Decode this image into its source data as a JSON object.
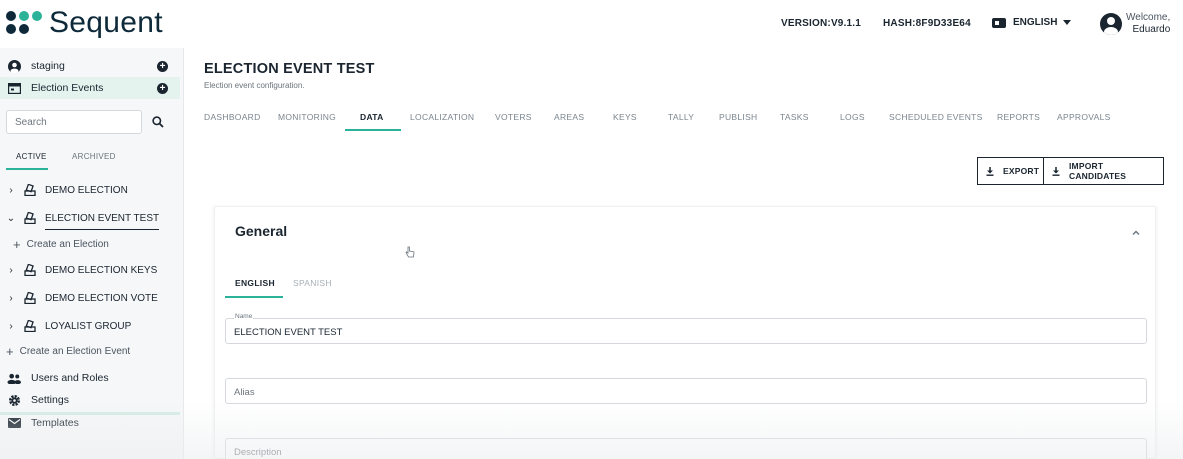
{
  "app": {
    "logo_text": "Sequent"
  },
  "header": {
    "version": "VERSION:V9.1.1",
    "hash": "HASH:8F9D33E64",
    "language": "ENGLISH",
    "welcome": "Welcome,",
    "user_name": "Eduardo"
  },
  "sidebar": {
    "tenant": "staging",
    "section": "Election Events",
    "search_placeholder": "Search",
    "tabs": {
      "active": "ACTIVE",
      "archived": "ARCHIVED"
    },
    "tree": [
      {
        "label": "DEMO ELECTION",
        "expanded": false
      },
      {
        "label": "ELECTION EVENT TEST",
        "expanded": true
      },
      {
        "label": "DEMO ELECTION KEYS",
        "expanded": false
      },
      {
        "label": "DEMO ELECTION VOTE",
        "expanded": false
      },
      {
        "label": "LOYALIST GROUP",
        "expanded": false
      }
    ],
    "create_election": "Create an Election",
    "create_event": "Create an Election Event",
    "bottom": [
      {
        "label": "Users and Roles",
        "icon": "users-icon"
      },
      {
        "label": "Settings",
        "icon": "gear-icon"
      },
      {
        "label": "Templates",
        "icon": "mail-icon"
      }
    ]
  },
  "main": {
    "title": "ELECTION EVENT TEST",
    "subtitle": "Election event configuration.",
    "tabs": [
      "DASHBOARD",
      "MONITORING",
      "DATA",
      "LOCALIZATION",
      "VOTERS",
      "AREAS",
      "KEYS",
      "TALLY",
      "PUBLISH",
      "TASKS",
      "LOGS",
      "SCHEDULED EVENTS",
      "REPORTS",
      "APPROVALS"
    ],
    "active_tab": "DATA",
    "buttons": {
      "export": "EXPORT",
      "import": "IMPORT CANDIDATES"
    },
    "card": {
      "title": "General",
      "lang_tabs": [
        "ENGLISH",
        "SPANISH"
      ],
      "fields": {
        "name_label": "Name",
        "name_value": "ELECTION EVENT TEST",
        "alias_placeholder": "Alias",
        "description_placeholder": "Description"
      }
    }
  },
  "colors": {
    "accent": "#2bb39a",
    "text": "#1a2530",
    "sidebar_bg": "#f6f7f8"
  }
}
